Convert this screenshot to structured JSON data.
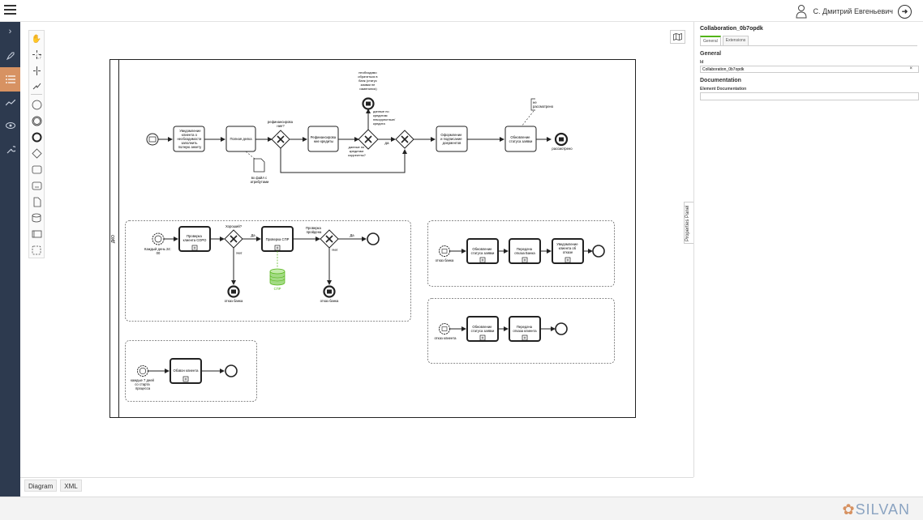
{
  "header": {
    "user_name": "С. Дмитрий Евгеньевич"
  },
  "sidebar": {
    "icons": [
      "chevron-right-icon",
      "rocket-icon",
      "list-icon",
      "trend-icon",
      "eye-icon",
      "wrench-icon"
    ]
  },
  "palette": {
    "tools": [
      "hand-tool-icon",
      "lasso-tool-icon",
      "space-tool-icon",
      "connect-tool-icon",
      "start-event-icon",
      "intermediate-event-icon",
      "end-event-icon",
      "gateway-icon",
      "task-icon",
      "subprocess-icon",
      "data-object-icon",
      "data-store-icon",
      "pool-icon",
      "group-icon"
    ]
  },
  "diagram": {
    "pool_label": "ДКО",
    "main": {
      "t1": [
        "Уведомление",
        "клиента о",
        "необходимости",
        "заполнить",
        "полную анкету"
      ],
      "t2": "Полная делка",
      "gw1": [
        "рефинансирова",
        "ние?"
      ],
      "t3": [
        "Рефинансирова",
        "ние кредиты"
      ],
      "end_top": [
        "необходимо",
        "обратиться в",
        "банк (статус",
        "заявки не",
        "изменился)"
      ],
      "gw2_label": [
        "данные по",
        "кредитам",
        "некорректные/",
        "кредита"
      ],
      "gw2_bottom": [
        "данные по",
        "кредитам",
        "корректны?"
      ],
      "da": "да",
      "t4": [
        "Оформление",
        "и подписание",
        "документов"
      ],
      "t5": [
        "Обновление",
        "статуса заявки"
      ],
      "annotation": [
        "не",
        "рассмотрено"
      ],
      "end_label": "рассмотрено",
      "file": [
        "вх файл с",
        "атрибутами"
      ]
    },
    "sub1": {
      "start": [
        "Каждый день 24:",
        "00"
      ],
      "t1": [
        "Проверка",
        "клиента СОРО"
      ],
      "gw1": "Хороший?",
      "yes": "Да",
      "no": "Нет",
      "t2": "Проверка СПР",
      "gw2": [
        "Проверка",
        "пройдена"
      ],
      "yes2": "Да",
      "no2": "Нет",
      "store": "СПР",
      "end1": "отказ банка",
      "end2": "отказ банка"
    },
    "sub2": {
      "start": "отказ банка",
      "t1": [
        "Обновление",
        "статуса заявки"
      ],
      "t2": [
        "Передача",
        "отказа Банка"
      ],
      "t3": [
        "Уведомление",
        "клиента об",
        "отказе"
      ]
    },
    "sub3": {
      "start": "отказ клиента",
      "t1": [
        "Обновление",
        "статуса заявки"
      ],
      "t2": [
        "Передача",
        "отказа клиента"
      ]
    },
    "sub4": {
      "start": [
        "каждые 7 дней",
        "со старта",
        "процесса"
      ],
      "t1": "Обзвон клиента"
    }
  },
  "properties": {
    "tab_label": "Properties Panel",
    "title": "Collaboration_0b7opdk",
    "tabs": [
      "General",
      "Extensions"
    ],
    "general_heading": "General",
    "id_label": "Id",
    "id_value": "Collaboration_0b7opdk",
    "doc_heading": "Documentation",
    "doc_label": "Element Documentation"
  },
  "bottom_tabs": [
    "Diagram",
    "XML"
  ],
  "footer": {
    "logo": "SILVAN"
  }
}
